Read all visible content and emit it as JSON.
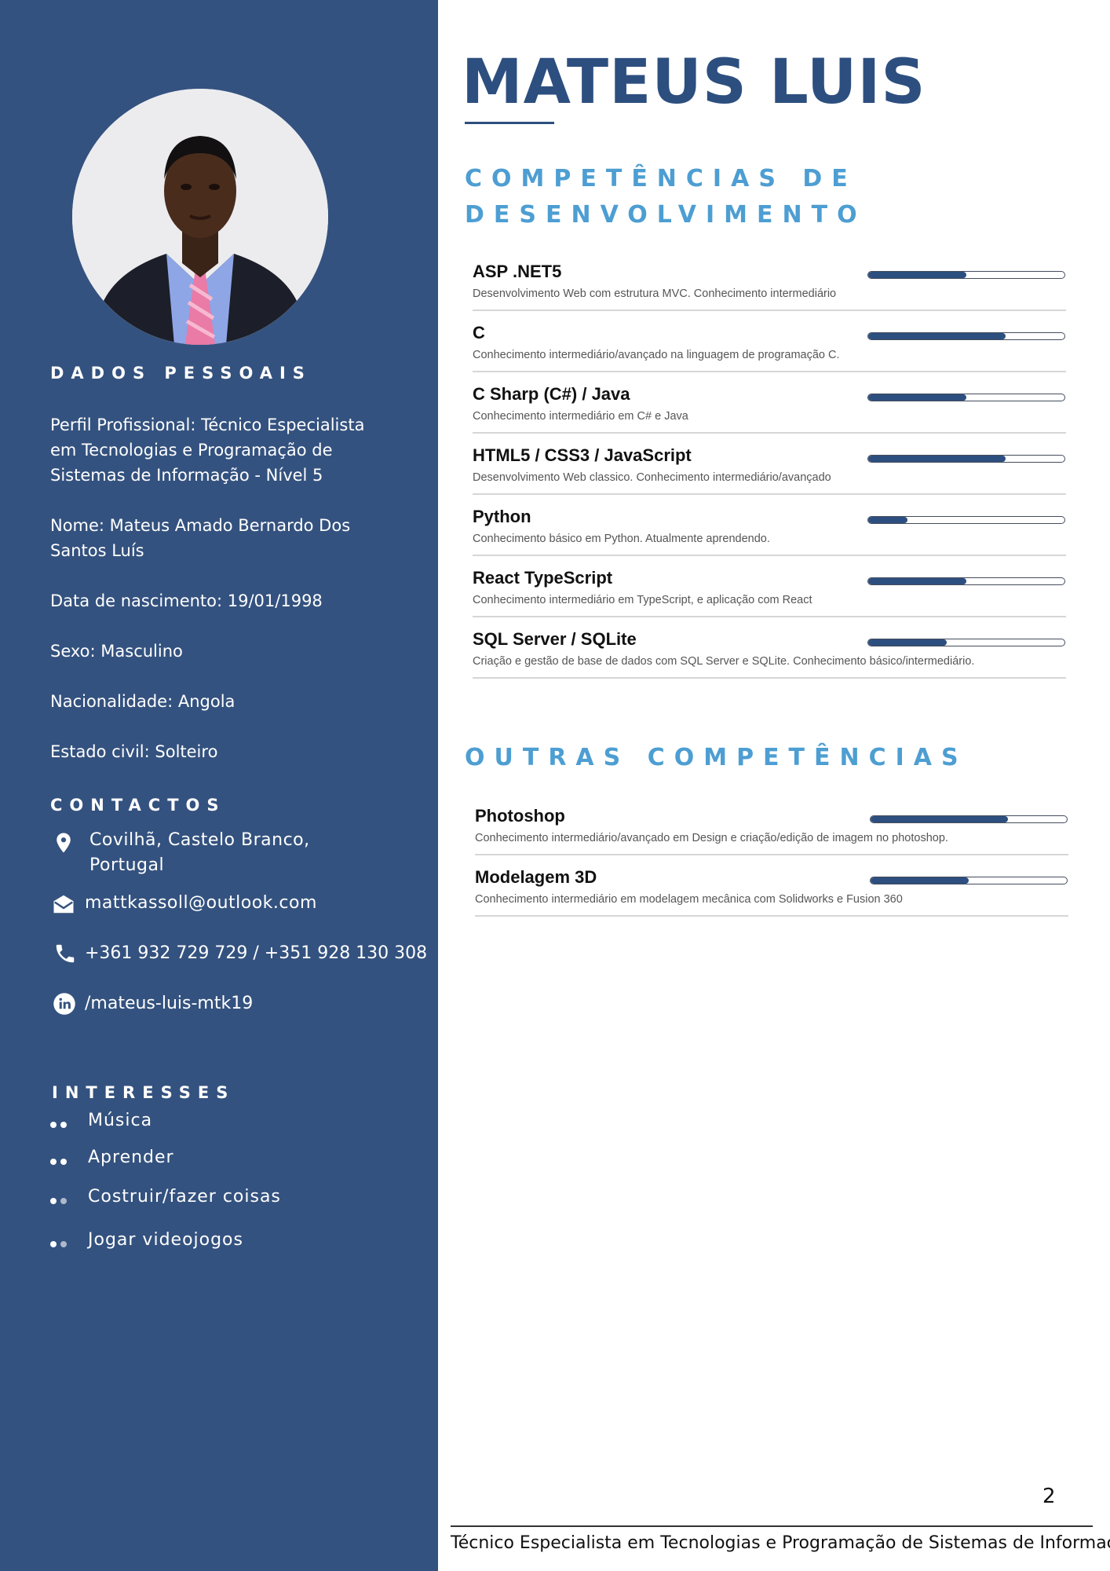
{
  "name": "MATEUS LUIS",
  "sidebar": {
    "personal_heading": "DADOS PESSOAIS",
    "profile": "Perfil Profissional: Técnico Especialista em Tecnologias e Programação de Sistemas de Informação - Nível 5",
    "full_name": "Nome: Mateus Amado Bernardo Dos Santos Luís",
    "birth": "Data de nascimento: 19/01/1998",
    "sex": "Sexo: Masculino",
    "nationality": "Nacionalidade: Angola",
    "civil": "Estado civil: Solteiro",
    "contacts_heading": "CONTACTOS",
    "location": "Covilhã, Castelo Branco, Portugal",
    "email": "mattkassoll@outlook.com",
    "phone": "+361 932 729 729  / +351 928 130 308",
    "linkedin": "/mateus-luis-mtk19",
    "interests_heading": "INTERESSES",
    "interests": [
      "Música",
      "Aprender",
      "Costruir/fazer coisas",
      "Jogar videojogos"
    ]
  },
  "dev_skills": {
    "title": "COMPETÊNCIAS DE DESENVOLVIMENTO",
    "items": [
      {
        "name": "ASP .NET5",
        "desc": "Desenvolvimento Web com estrutura MVC. Conhecimento intermediário",
        "level": 0.5
      },
      {
        "name": "C",
        "desc": "Conhecimento intermediário/avançado na linguagem de programação C.",
        "level": 0.7
      },
      {
        "name": "C Sharp (C#) / Java",
        "desc": "Conhecimento intermediário em C# e Java",
        "level": 0.5
      },
      {
        "name": "HTML5 / CSS3 / JavaScript",
        "desc": "Desenvolvimento Web classico. Conhecimento intermediário/avançado",
        "level": 0.7
      },
      {
        "name": "Python",
        "desc": "Conhecimento básico em Python. Atualmente aprendendo.",
        "level": 0.2
      },
      {
        "name": "React TypeScript",
        "desc": "Conhecimento intermediário em TypeScript, e aplicação com React",
        "level": 0.5
      },
      {
        "name": "SQL Server / SQLite",
        "desc": "Criação e gestão de base de dados com SQL Server e SQLite. Conhecimento básico/intermediário.",
        "level": 0.4
      }
    ]
  },
  "other_skills": {
    "title": "OUTRAS COMPETÊNCIAS",
    "items": [
      {
        "name": "Photoshop",
        "desc": "Conhecimento intermediário/avançado em Design e criação/edição de imagem no photoshop.",
        "level": 0.7
      },
      {
        "name": "Modelagem 3D",
        "desc": "Conhecimento intermediário em modelagem mecânica com Solidworks e Fusion 360",
        "level": 0.5
      }
    ]
  },
  "footer": {
    "page_number": "2",
    "text": "Técnico Especialista em Tecnologias e Programação de Sistemas de Informação"
  },
  "colors": {
    "sidebar": "#34527f",
    "accent": "#4d9ed2",
    "name": "#2d4f7f"
  }
}
